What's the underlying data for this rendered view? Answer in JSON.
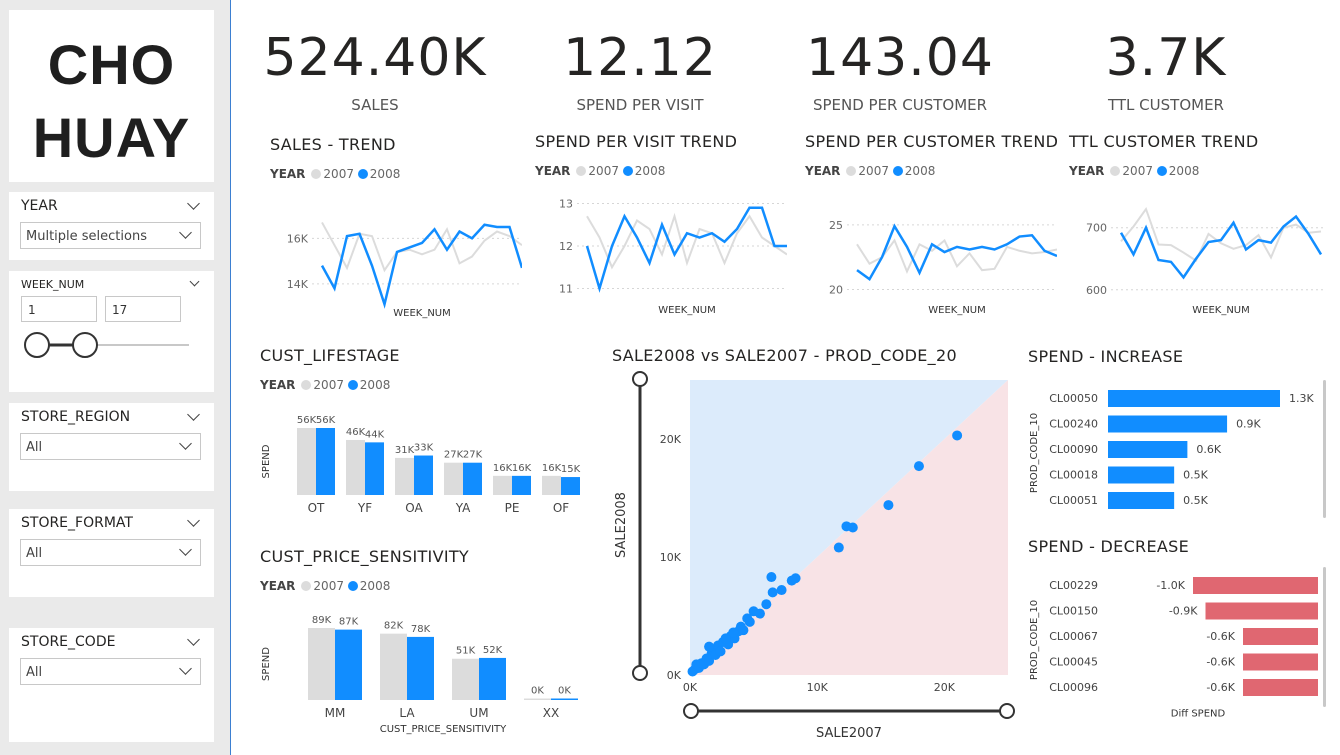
{
  "logo": {
    "line1": "CHO",
    "line2": "HUAY"
  },
  "slicers": {
    "year": {
      "title": "YEAR",
      "value": "Multiple selections"
    },
    "week": {
      "title": "WEEK_NUM",
      "from": "1",
      "to": "17"
    },
    "region": {
      "title": "STORE_REGION",
      "value": "All"
    },
    "format": {
      "title": "STORE_FORMAT",
      "value": "All"
    },
    "code": {
      "title": "STORE_CODE",
      "value": "All"
    }
  },
  "kpis": [
    {
      "value": "524.40K",
      "label": "SALES"
    },
    {
      "value": "12.12",
      "label": "SPEND PER VISIT"
    },
    {
      "value": "143.04",
      "label": "SPEND PER CUSTOMER"
    },
    {
      "value": "3.7K",
      "label": "TTL CUSTOMER"
    }
  ],
  "legend": {
    "title": "YEAR",
    "y1": "2007",
    "y2": "2008"
  },
  "colors": {
    "y2007": "#dcdcdc",
    "y2008": "#118dff",
    "increase": "#118dff",
    "decrease": "#e06771",
    "above": "#dcebfb",
    "below": "#f8e3e6"
  },
  "chart_data": [
    {
      "type": "line",
      "title": "SALES - TREND",
      "xlabel": "WEEK_NUM",
      "ylabel": "",
      "yticks": [
        "16K",
        "14K"
      ],
      "ylim": [
        13200,
        17600
      ],
      "x": [
        1,
        2,
        3,
        4,
        5,
        6,
        7,
        8,
        9,
        10,
        11,
        12,
        13,
        14,
        15,
        16,
        17
      ],
      "series": [
        {
          "name": "2007",
          "values": [
            16700,
            15700,
            14700,
            16200,
            16100,
            14600,
            15400,
            15500,
            15300,
            15500,
            16400,
            14900,
            15200,
            15900,
            16300,
            16100,
            15700
          ]
        },
        {
          "name": "2008",
          "values": [
            14800,
            13800,
            16100,
            16200,
            14800,
            13100,
            15400,
            15600,
            15800,
            16400,
            15500,
            16300,
            16000,
            16600,
            16500,
            16500,
            14700
          ]
        }
      ]
    },
    {
      "type": "line",
      "title": "SPEND PER VISIT TREND",
      "xlabel": "WEEK_NUM",
      "ylabel": "",
      "yticks": [
        "13",
        "12",
        "11"
      ],
      "ylim": [
        10.8,
        13.2
      ],
      "x": [
        1,
        2,
        3,
        4,
        5,
        6,
        7,
        8,
        9,
        10,
        11,
        12,
        13,
        14,
        15,
        16,
        17
      ],
      "series": [
        {
          "name": "2007",
          "values": [
            12.7,
            12.2,
            11.5,
            12.0,
            12.6,
            12.4,
            11.8,
            12.7,
            11.6,
            12.4,
            12.3,
            11.6,
            12.3,
            12.7,
            12.2,
            12.0,
            11.8
          ]
        },
        {
          "name": "2008",
          "values": [
            12.0,
            11.0,
            12.0,
            12.7,
            12.2,
            11.6,
            12.5,
            11.8,
            12.3,
            12.2,
            12.3,
            12.1,
            12.4,
            12.9,
            12.9,
            12.0,
            12.0
          ]
        }
      ]
    },
    {
      "type": "line",
      "title": "SPEND PER CUSTOMER TREND",
      "xlabel": "WEEK_NUM",
      "ylabel": "",
      "yticks": [
        "25",
        "20"
      ],
      "ylim": [
        19.5,
        26
      ],
      "x": [
        1,
        2,
        3,
        4,
        5,
        6,
        7,
        8,
        9,
        10,
        11,
        12,
        13,
        14,
        15,
        16,
        17
      ],
      "series": [
        {
          "name": "2007",
          "values": [
            23.5,
            22.0,
            22.5,
            23.8,
            21.4,
            23.5,
            23.0,
            23.8,
            21.8,
            22.8,
            21.5,
            21.6,
            23.3,
            23.0,
            22.8,
            22.9,
            23.1
          ]
        },
        {
          "name": "2008",
          "values": [
            21.5,
            20.8,
            22.5,
            24.9,
            23.3,
            21.3,
            23.5,
            22.9,
            23.3,
            23.1,
            23.3,
            23.1,
            23.5,
            24.1,
            24.2,
            23.0,
            22.6
          ]
        }
      ]
    },
    {
      "type": "line",
      "title": "TTL CUSTOMER TREND",
      "xlabel": "WEEK_NUM",
      "ylabel": "",
      "yticks": [
        "700",
        "600"
      ],
      "ylim": [
        590,
        735
      ],
      "x": [
        1,
        2,
        3,
        4,
        5,
        6,
        7,
        8,
        9,
        10,
        11,
        12,
        13,
        14,
        15,
        16,
        17
      ],
      "series": [
        {
          "name": "2007",
          "values": [
            678,
            702,
            730,
            673,
            672,
            660,
            647,
            690,
            675,
            666,
            672,
            688,
            652,
            700,
            705,
            692,
            694
          ]
        },
        {
          "name": "2008",
          "values": [
            692,
            657,
            700,
            648,
            645,
            620,
            650,
            677,
            680,
            708,
            665,
            680,
            676,
            702,
            718,
            690,
            657
          ]
        }
      ]
    },
    {
      "type": "bar",
      "title": "CUST_LIFESTAGE",
      "ylabel": "SPEND",
      "xlabel": "",
      "categories": [
        "OT",
        "YF",
        "OA",
        "YA",
        "PE",
        "OF"
      ],
      "labels2007": [
        "56K",
        "46K",
        "31K",
        "27K",
        "16K",
        "16K"
      ],
      "labels2008": [
        "56K",
        "44K",
        "33K",
        "27K",
        "16K",
        "15K"
      ],
      "series": [
        {
          "name": "2007",
          "values": [
            56000,
            46000,
            31000,
            27000,
            16000,
            16000
          ]
        },
        {
          "name": "2008",
          "values": [
            56000,
            44000,
            33000,
            27000,
            16000,
            15000
          ]
        }
      ]
    },
    {
      "type": "bar",
      "title": "CUST_PRICE_SENSITIVITY",
      "ylabel": "SPEND",
      "xlabel": "CUST_PRICE_SENSITIVITY",
      "categories": [
        "MM",
        "LA",
        "UM",
        "XX"
      ],
      "labels2007": [
        "89K",
        "82K",
        "51K",
        "0K"
      ],
      "labels2008": [
        "87K",
        "78K",
        "52K",
        "0K"
      ],
      "series": [
        {
          "name": "2007",
          "values": [
            89000,
            82000,
            51000,
            0
          ]
        },
        {
          "name": "2008",
          "values": [
            87000,
            78000,
            52000,
            0
          ]
        }
      ]
    },
    {
      "type": "scatter",
      "title": "SALE2008 vs SALE2007 - PROD_CODE_20",
      "xlabel": "SALE2007",
      "ylabel": "SALE2008",
      "xticks": [
        "0K",
        "10K",
        "20K"
      ],
      "yticks": [
        "20K",
        "10K",
        "0K"
      ],
      "xlim": [
        0,
        25000
      ],
      "ylim": [
        0,
        25000
      ],
      "points": [
        [
          200,
          300
        ],
        [
          400,
          500
        ],
        [
          500,
          900
        ],
        [
          700,
          600
        ],
        [
          900,
          1000
        ],
        [
          1100,
          900
        ],
        [
          1300,
          1400
        ],
        [
          1500,
          1200
        ],
        [
          1700,
          1800
        ],
        [
          1800,
          2100
        ],
        [
          2000,
          1700
        ],
        [
          2200,
          2500
        ],
        [
          2400,
          2000
        ],
        [
          2600,
          2800
        ],
        [
          2800,
          3000
        ],
        [
          3000,
          2600
        ],
        [
          3200,
          3300
        ],
        [
          3500,
          3100
        ],
        [
          3800,
          3700
        ],
        [
          4000,
          4100
        ],
        [
          4200,
          3800
        ],
        [
          4500,
          4800
        ],
        [
          4700,
          4500
        ],
        [
          5000,
          5400
        ],
        [
          5500,
          5200
        ],
        [
          6000,
          6000
        ],
        [
          6500,
          7000
        ],
        [
          7200,
          7200
        ],
        [
          8000,
          8000
        ],
        [
          8300,
          8200
        ],
        [
          6400,
          8300
        ],
        [
          1500,
          2400
        ],
        [
          2800,
          3100
        ],
        [
          3400,
          3600
        ],
        [
          11700,
          10800
        ],
        [
          12300,
          12600
        ],
        [
          12800,
          12500
        ],
        [
          15600,
          14400
        ],
        [
          18000,
          17700
        ],
        [
          21000,
          20300
        ]
      ]
    },
    {
      "type": "bar",
      "title": "SPEND - INCREASE",
      "ylabel": "PROD_CODE_10",
      "xlabel": "",
      "categories": [
        "CL00050",
        "CL00240",
        "CL00090",
        "CL00018",
        "CL00051"
      ],
      "labels": [
        "1.3K",
        "0.9K",
        "0.6K",
        "0.5K",
        "0.5K"
      ],
      "values": [
        1300,
        900,
        600,
        500,
        500
      ]
    },
    {
      "type": "bar",
      "title": "SPEND - DECREASE",
      "ylabel": "PROD_CODE_10",
      "xlabel": "Diff SPEND",
      "categories": [
        "CL00229",
        "CL00150",
        "CL00067",
        "CL00045",
        "CL00096"
      ],
      "labels": [
        "-1.0K",
        "-0.9K",
        "-0.6K",
        "-0.6K",
        "-0.6K"
      ],
      "values": [
        -1000,
        -900,
        -600,
        -600,
        -600
      ]
    }
  ]
}
